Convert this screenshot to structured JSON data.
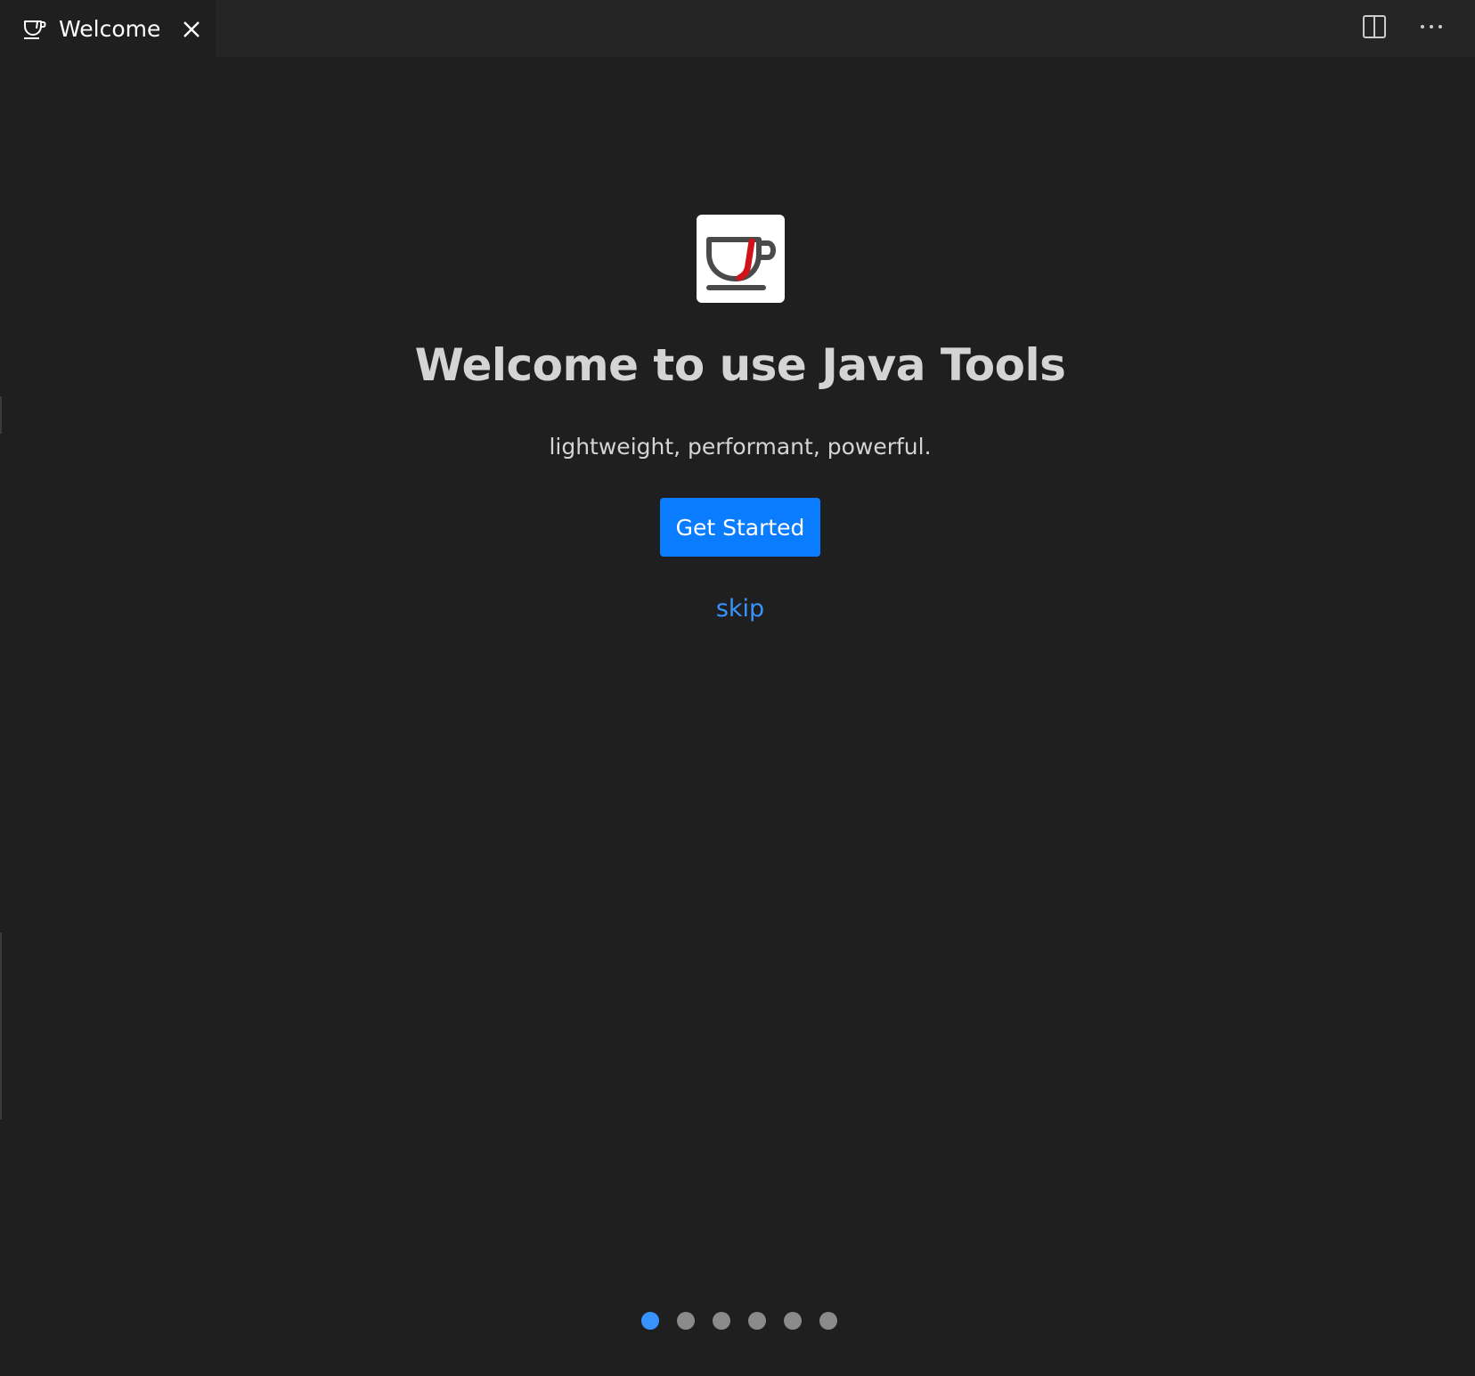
{
  "tab": {
    "label": "Welcome",
    "icon": "coffee-cup-icon",
    "close_icon": "close-icon"
  },
  "actions": {
    "split_icon": "split-editor-icon",
    "more_icon": "more-actions-icon"
  },
  "welcome": {
    "logo_icon": "java-coffee-cup-logo",
    "title": "Welcome to use Java Tools",
    "subtitle": "lightweight, performant, powerful.",
    "primary_button": "Get Started",
    "skip_link": "skip"
  },
  "pagination": {
    "total": 6,
    "active_index": 0
  },
  "colors": {
    "accent": "#0a7cff",
    "link": "#3794ff",
    "logo_red": "#d0121a",
    "background": "#1f1f1f"
  }
}
